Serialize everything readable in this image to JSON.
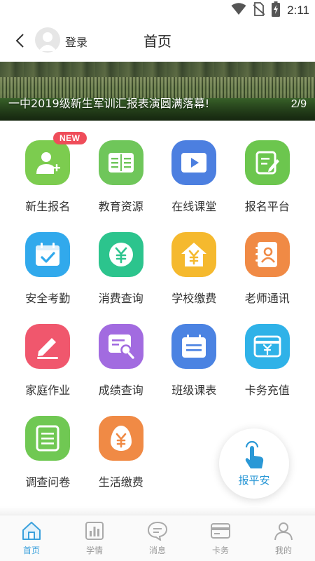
{
  "status_bar": {
    "time": "2:11"
  },
  "header": {
    "login_label": "登录",
    "title": "首页"
  },
  "banner": {
    "caption": "一中2019级新生军训汇报表演圆满落幕!",
    "index": "2/9"
  },
  "grid_items": [
    {
      "label": "新生报名",
      "icon": "new-student-icon",
      "color": "#7ccc4f",
      "badge": "NEW"
    },
    {
      "label": "教育资源",
      "icon": "book-icon",
      "color": "#6fc65a"
    },
    {
      "label": "在线课堂",
      "icon": "video-play-icon",
      "color": "#4c7fe0"
    },
    {
      "label": "报名平台",
      "icon": "edit-form-icon",
      "color": "#6cc64e"
    },
    {
      "label": "安全考勤",
      "icon": "calendar-check-icon",
      "color": "#31a9ec"
    },
    {
      "label": "消费查询",
      "icon": "yuan-coin-icon",
      "color": "#2cc48d"
    },
    {
      "label": "学校缴费",
      "icon": "house-yuan-icon",
      "color": "#f5b92e"
    },
    {
      "label": "老师通讯",
      "icon": "contact-book-icon",
      "color": "#f08a45"
    },
    {
      "label": "家庭作业",
      "icon": "pencil-icon",
      "color": "#f0576d"
    },
    {
      "label": "成绩查询",
      "icon": "report-search-icon",
      "color": "#a26be0"
    },
    {
      "label": "班级课表",
      "icon": "timetable-icon",
      "color": "#4b83e2"
    },
    {
      "label": "卡务充值",
      "icon": "card-yuan-icon",
      "color": "#2fb2e8"
    },
    {
      "label": "调查问卷",
      "icon": "questionnaire-icon",
      "color": "#70c853"
    },
    {
      "label": "生活缴费",
      "icon": "egg-yuan-icon",
      "color": "#f08a45"
    }
  ],
  "float_button": {
    "label": "报平安",
    "icon": "tap-hand-icon",
    "color": "#2a98d6"
  },
  "bottom_nav": [
    {
      "label": "首页",
      "icon": "home-icon",
      "active": true
    },
    {
      "label": "学情",
      "icon": "chart-icon",
      "active": false
    },
    {
      "label": "消息",
      "icon": "message-icon",
      "active": false
    },
    {
      "label": "卡务",
      "icon": "card-icon",
      "active": false
    },
    {
      "label": "我的",
      "icon": "user-icon",
      "active": false
    }
  ],
  "colors": {
    "accent": "#3aa0dc",
    "nav_inactive": "#999999",
    "badge": "#ef4d5a"
  }
}
